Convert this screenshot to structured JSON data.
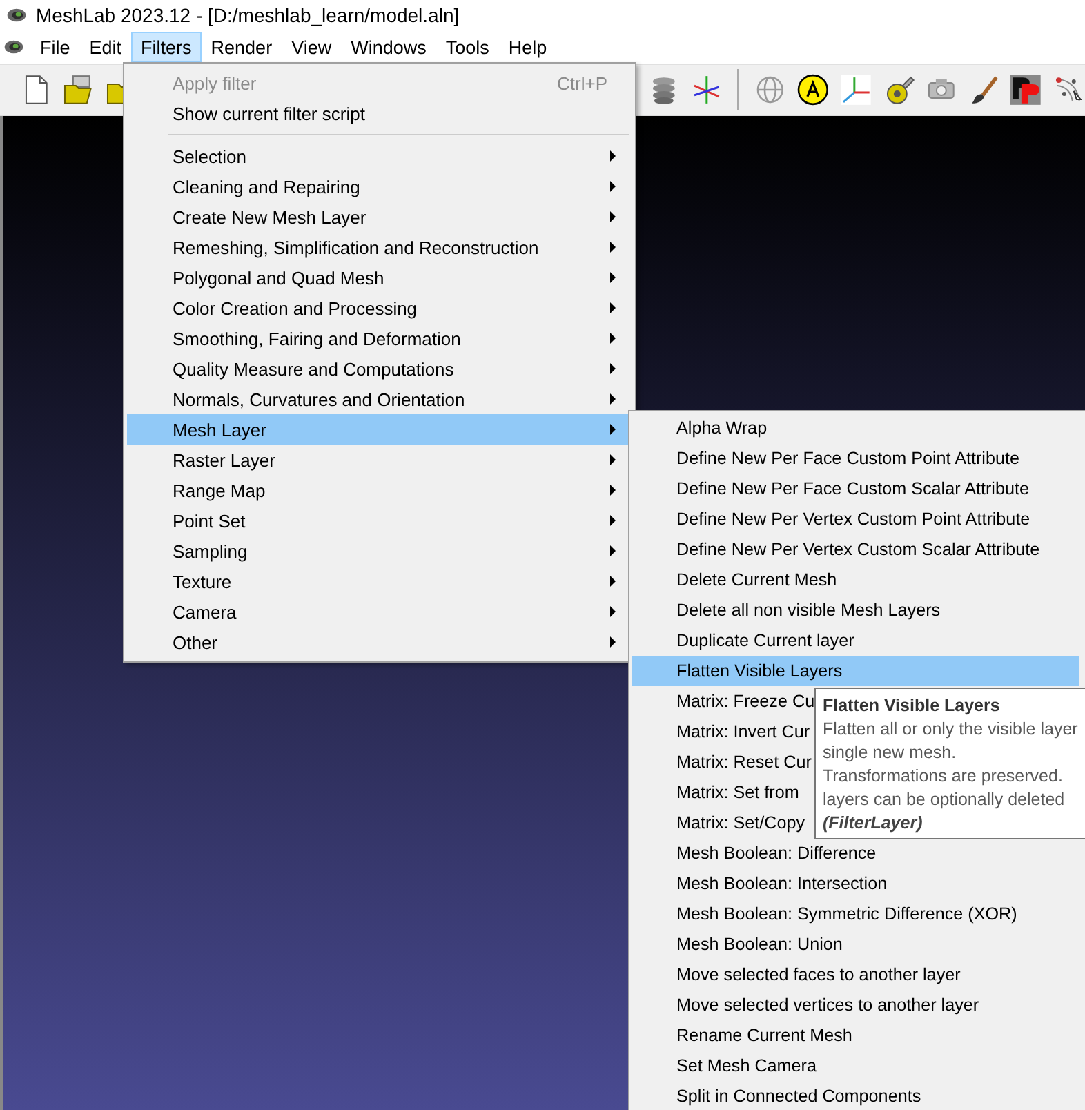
{
  "window": {
    "title": "MeshLab 2023.12 - [D:/meshlab_learn/model.aln]"
  },
  "menu_bar": [
    {
      "label": "File",
      "selected": false
    },
    {
      "label": "Edit",
      "selected": false
    },
    {
      "label": "Filters",
      "selected": true
    },
    {
      "label": "Render",
      "selected": false
    },
    {
      "label": "View",
      "selected": false
    },
    {
      "label": "Windows",
      "selected": false
    },
    {
      "label": "Tools",
      "selected": false
    },
    {
      "label": "Help",
      "selected": false
    }
  ],
  "toolbar": [
    {
      "kind": "new"
    },
    {
      "kind": "open-project"
    },
    {
      "kind": "open"
    },
    {
      "kind": "layers"
    },
    {
      "kind": "axes-xyz"
    },
    {
      "kind": "separator"
    },
    {
      "kind": "globe"
    },
    {
      "kind": "letter-a"
    },
    {
      "kind": "axes"
    },
    {
      "kind": "tape"
    },
    {
      "kind": "camera"
    },
    {
      "kind": "brush"
    },
    {
      "kind": "pp"
    },
    {
      "kind": "points"
    }
  ],
  "filters_menu": [
    {
      "kind": "item",
      "label": "Apply filter",
      "shortcut": "Ctrl+P",
      "disabled": true,
      "selected": false
    },
    {
      "kind": "item",
      "label": "Show current filter script",
      "disabled": false,
      "selected": false
    },
    {
      "kind": "separator"
    },
    {
      "kind": "submenu",
      "label": "Selection",
      "selected": false
    },
    {
      "kind": "submenu",
      "label": "Cleaning and Repairing",
      "selected": false
    },
    {
      "kind": "submenu",
      "label": "Create New Mesh Layer",
      "selected": false
    },
    {
      "kind": "submenu",
      "label": "Remeshing, Simplification and Reconstruction",
      "selected": false
    },
    {
      "kind": "submenu",
      "label": "Polygonal and Quad Mesh",
      "selected": false
    },
    {
      "kind": "submenu",
      "label": "Color Creation and Processing",
      "selected": false
    },
    {
      "kind": "submenu",
      "label": "Smoothing, Fairing and Deformation",
      "selected": false
    },
    {
      "kind": "submenu",
      "label": "Quality Measure and Computations",
      "selected": false
    },
    {
      "kind": "submenu",
      "label": "Normals, Curvatures and Orientation",
      "selected": false
    },
    {
      "kind": "submenu",
      "label": "Mesh Layer",
      "selected": true
    },
    {
      "kind": "submenu",
      "label": "Raster Layer",
      "selected": false
    },
    {
      "kind": "submenu",
      "label": "Range Map",
      "selected": false
    },
    {
      "kind": "submenu",
      "label": "Point Set",
      "selected": false
    },
    {
      "kind": "submenu",
      "label": "Sampling",
      "selected": false
    },
    {
      "kind": "submenu",
      "label": "Texture",
      "selected": false
    },
    {
      "kind": "submenu",
      "label": "Camera",
      "selected": false
    },
    {
      "kind": "submenu",
      "label": "Other",
      "selected": false
    }
  ],
  "mesh_layer_menu": [
    {
      "label": "Alpha Wrap",
      "selected": false
    },
    {
      "label": "Define New Per Face Custom Point Attribute",
      "selected": false
    },
    {
      "label": "Define New Per Face Custom Scalar Attribute",
      "selected": false
    },
    {
      "label": "Define New Per Vertex Custom Point Attribute",
      "selected": false
    },
    {
      "label": "Define New Per Vertex Custom Scalar Attribute",
      "selected": false
    },
    {
      "label": "Delete Current Mesh",
      "selected": false
    },
    {
      "label": "Delete all non visible Mesh Layers",
      "selected": false
    },
    {
      "label": "Duplicate Current layer",
      "selected": false
    },
    {
      "label": "Flatten Visible Layers",
      "selected": true
    },
    {
      "label": "Matrix: Freeze Cu",
      "selected": false
    },
    {
      "label": "Matrix: Invert Cur",
      "selected": false
    },
    {
      "label": "Matrix: Reset Cur",
      "selected": false
    },
    {
      "label": "Matrix: Set from",
      "selected": false
    },
    {
      "label": "Matrix: Set/Copy",
      "selected": false
    },
    {
      "label": "Mesh Boolean: Difference",
      "selected": false
    },
    {
      "label": "Mesh Boolean: Intersection",
      "selected": false
    },
    {
      "label": "Mesh Boolean: Symmetric Difference (XOR)",
      "selected": false
    },
    {
      "label": "Mesh Boolean: Union",
      "selected": false
    },
    {
      "label": "Move selected faces to another layer",
      "selected": false
    },
    {
      "label": "Move selected vertices to another layer",
      "selected": false
    },
    {
      "label": "Rename Current Mesh",
      "selected": false
    },
    {
      "label": "Set Mesh Camera",
      "selected": false
    },
    {
      "label": "Split in Connected Components",
      "selected": false
    }
  ],
  "tooltip": {
    "title": "Flatten Visible Layers",
    "lines": [
      "Flatten all or only the visible layer",
      "single new mesh.",
      "Transformations are preserved.",
      "layers can be optionally deleted"
    ],
    "footer": "(FilterLayer)"
  }
}
